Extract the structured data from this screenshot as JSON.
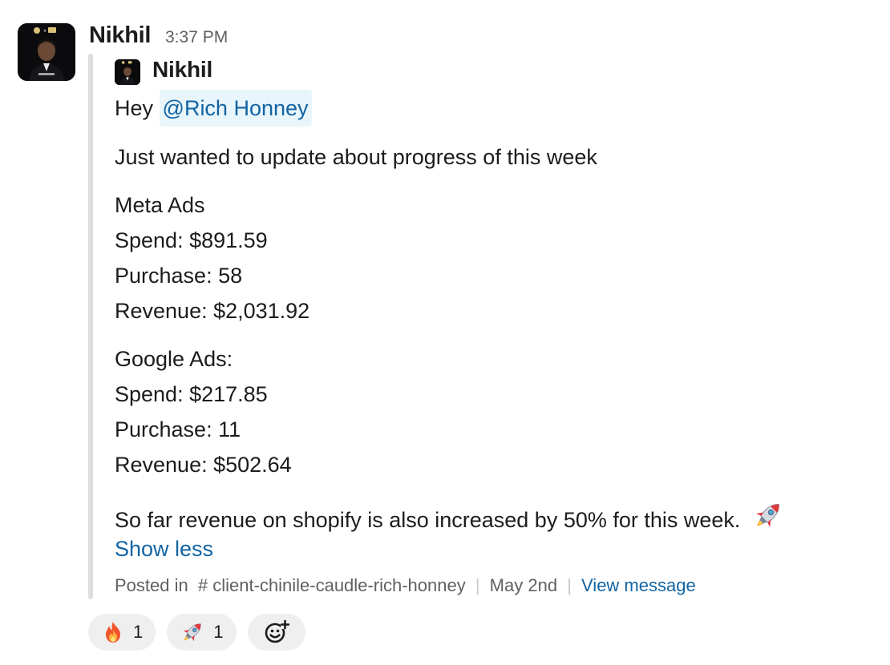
{
  "message": {
    "sender": "Nikhil",
    "time": "3:37 PM",
    "avatar_icon": "person-photo-icon"
  },
  "shared": {
    "author": "Nikhil",
    "greeting": "Hey",
    "mention": "@Rich Honney",
    "intro": "Just wanted to update about progress of this week",
    "meta_ads": {
      "heading": "Meta Ads",
      "spend": "Spend: $891.59",
      "purchase": "Purchase: 58",
      "revenue": "Revenue: $2,031.92"
    },
    "google_ads": {
      "heading": "Google Ads:",
      "spend": "Spend: $217.85",
      "purchase": "Purchase: 11",
      "revenue": "Revenue: $502.64"
    },
    "summary": "So far revenue on shopify is also increased by 50% for this week.",
    "summary_emoji": "rocket-icon",
    "show_less": "Show less"
  },
  "footer": {
    "posted_in": "Posted in",
    "channel": "# client-chinile-caudle-rich-honney",
    "date": "May 2nd",
    "view_message": "View message"
  },
  "reactions": [
    {
      "emoji": "fire-icon",
      "count": "1"
    },
    {
      "emoji": "rocket-icon",
      "count": "1"
    },
    {
      "emoji": "add-reaction-icon"
    }
  ],
  "colors": {
    "link": "#1264a3",
    "mention_bg": "#e8f5fa",
    "muted": "#616061",
    "quote_bar": "#dddddd",
    "reaction_bg": "#efefef"
  }
}
